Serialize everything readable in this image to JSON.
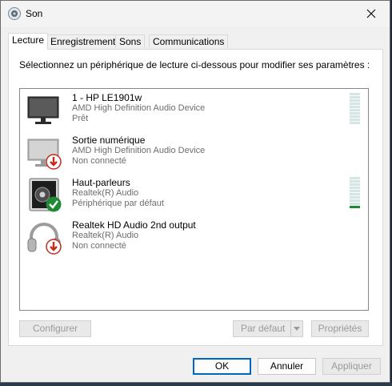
{
  "window": {
    "title": "Son"
  },
  "tabs": [
    "Lecture",
    "Enregistrement",
    "Sons",
    "Communications"
  ],
  "panel": {
    "instruction": "Sélectionnez un périphérique de lecture ci-dessous pour modifier ses paramètres :"
  },
  "devices": [
    {
      "name": "1 - HP LE1901w",
      "driver": "AMD High Definition Audio Device",
      "status": "Prêt",
      "icon": "monitor-icon",
      "overlay": "none"
    },
    {
      "name": "Sortie numérique",
      "driver": "AMD High Definition Audio Device",
      "status": "Non connecté",
      "icon": "monitor-icon",
      "overlay": "red-down-arrow"
    },
    {
      "name": "Haut-parleurs",
      "driver": "Realtek(R) Audio",
      "status": "Périphérique par défaut",
      "icon": "speaker-icon",
      "overlay": "green-check"
    },
    {
      "name": "Realtek HD Audio 2nd output",
      "driver": "Realtek(R) Audio",
      "status": "Non connecté",
      "icon": "headphones-icon",
      "overlay": "red-down-arrow"
    }
  ],
  "buttons": {
    "configure": "Configurer",
    "set_default": "Par défaut",
    "properties": "Propriétés",
    "ok": "OK",
    "cancel": "Annuler",
    "apply": "Appliquer"
  },
  "colors": {
    "accent": "#0067c0",
    "check": "#1f8a34",
    "error": "#c42b1c"
  }
}
